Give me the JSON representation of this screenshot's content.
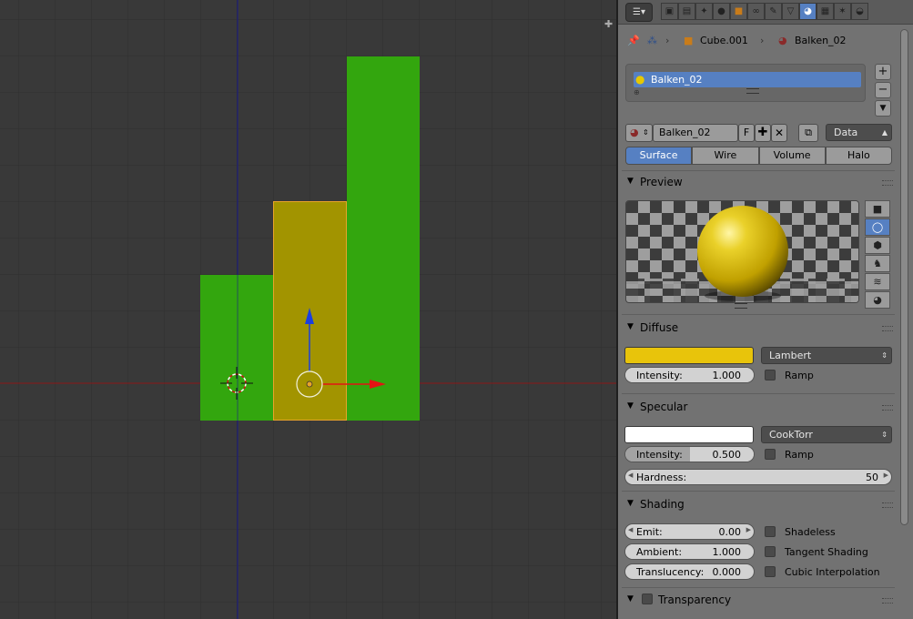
{
  "viewport": {
    "bars": [
      {
        "name": "bar-left",
        "color": "#33a60e"
      },
      {
        "name": "bar-selected",
        "color": "#a29400",
        "outline": "#e8a32a"
      },
      {
        "name": "bar-right",
        "color": "#33a60e"
      }
    ],
    "axis_colors": {
      "x": "#8a1818",
      "y": "#1a1a8a"
    },
    "manipulator": {
      "x_arrow": "#e31414",
      "y_arrow": "#1a3fe0"
    }
  },
  "header": {
    "menu_icon": "editor-type-icon",
    "context_tabs": [
      "render-icon",
      "render-layers-icon",
      "scene-icon",
      "world-icon",
      "object-icon",
      "constraint-icon",
      "modifier-icon",
      "object-data-icon",
      "material-icon",
      "texture-icon",
      "particles-icon",
      "physics-icon"
    ],
    "active_tab": "material-icon"
  },
  "breadcrumb": {
    "object": "Cube.001",
    "material": "Balken_02"
  },
  "material_slots": {
    "items": [
      {
        "label": "Balken_02"
      }
    ],
    "add": "+",
    "remove": "−"
  },
  "material_selector": {
    "name": "Balken_02",
    "fake_user": "F",
    "link_mode": "Data"
  },
  "shading_tabs": [
    {
      "label": "Surface",
      "active": true
    },
    {
      "label": "Wire",
      "active": false
    },
    {
      "label": "Volume",
      "active": false
    },
    {
      "label": "Halo",
      "active": false
    }
  ],
  "preview": {
    "title": "Preview",
    "sphere_color": "#e7c800"
  },
  "diffuse": {
    "title": "Diffuse",
    "color": "#e8c40b",
    "shader": "Lambert",
    "intensity_label": "Intensity:",
    "intensity_value": "1.000",
    "intensity": 1.0,
    "ramp_label": "Ramp"
  },
  "specular": {
    "title": "Specular",
    "color": "#ffffff",
    "shader": "CookTorr",
    "intensity_label": "Intensity:",
    "intensity_value": "0.500",
    "intensity": 0.5,
    "ramp_label": "Ramp",
    "hardness_label": "Hardness:",
    "hardness_value": "50"
  },
  "shading": {
    "title": "Shading",
    "emit_label": "Emit:",
    "emit_value": "0.00",
    "ambient_label": "Ambient:",
    "ambient_value": "1.000",
    "ambient": 1.0,
    "translucency_label": "Translucency:",
    "translucency_value": "0.000",
    "shadeless_label": "Shadeless",
    "tangent_label": "Tangent Shading",
    "cubic_label": "Cubic Interpolation"
  },
  "transparency": {
    "title": "Transparency"
  },
  "colors": {
    "accent": "#5680c2",
    "panel_bg": "#727272"
  }
}
